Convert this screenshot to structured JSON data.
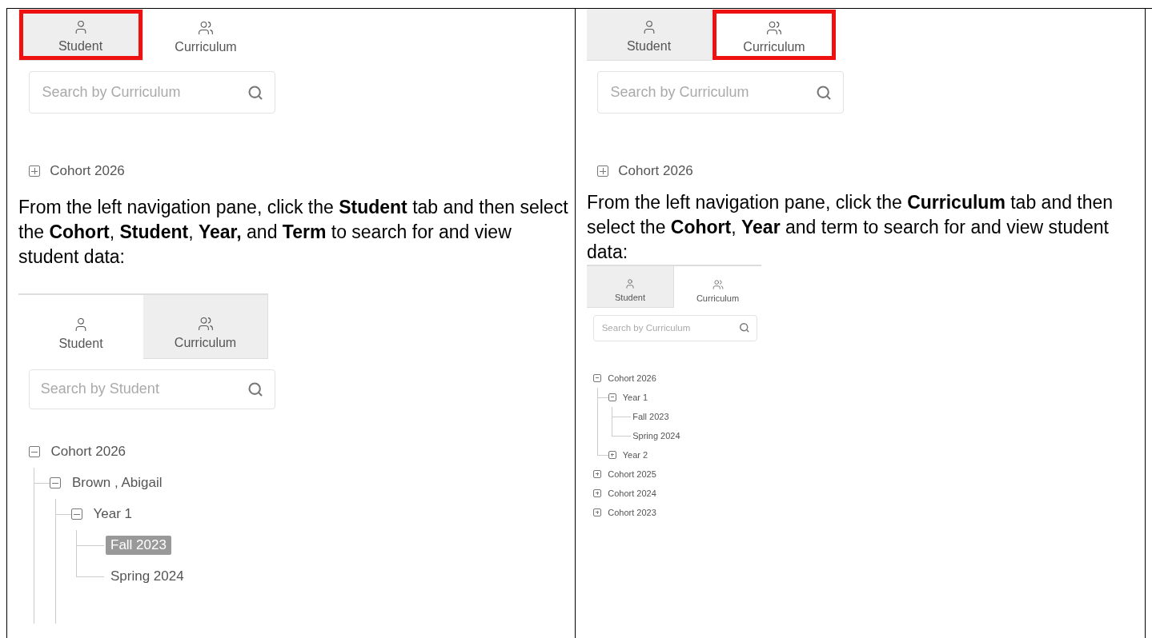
{
  "columns": [
    {
      "screenshot": {
        "kind": "cropped",
        "tabs": [
          {
            "label": "Student",
            "selected": false,
            "highlighted": true
          },
          {
            "label": "Curriculum",
            "selected": true,
            "highlighted": false
          }
        ],
        "search": {
          "placeholder": "Search by Curriculum"
        },
        "tree": [
          {
            "label": "Cohort 2026",
            "expanded": false,
            "selected": false
          }
        ]
      },
      "instruction": "From the left navigation pane, click the **Student** tab and then select the **Cohort**, **Student**, **Year,** and **Term** to search for and view student data:",
      "example": {
        "kind": "full",
        "tabs": [
          {
            "label": "Student",
            "selected": true,
            "highlighted": false
          },
          {
            "label": "Curriculum",
            "selected": false,
            "highlighted": false
          }
        ],
        "search": {
          "placeholder": "Search by Student"
        },
        "tree": [
          {
            "label": "Cohort 2026",
            "expanded": true,
            "continues": true,
            "selected": false,
            "children": [
              {
                "label": "Brown , Abigail",
                "expanded": true,
                "continues": true,
                "selected": false,
                "children": [
                  {
                    "label": "Year 1",
                    "expanded": true,
                    "continues": false,
                    "selected": false,
                    "children": [
                      {
                        "label": "Fall 2023",
                        "selected": true
                      },
                      {
                        "label": "Spring 2024",
                        "selected": false
                      }
                    ]
                  }
                ]
              }
            ]
          }
        ]
      }
    },
    {
      "screenshot": {
        "kind": "cropped",
        "tabs": [
          {
            "label": "Student",
            "selected": false,
            "highlighted": false
          },
          {
            "label": "Curriculum",
            "selected": true,
            "highlighted": true
          }
        ],
        "search": {
          "placeholder": "Search by Curriculum"
        },
        "tree": [
          {
            "label": "Cohort 2026",
            "expanded": false,
            "selected": false
          }
        ]
      },
      "instruction": "From the left navigation pane, click the **Curriculum** tab and then select the **Cohort**, **Year** and term to search for and view student data:",
      "example": {
        "kind": "compact",
        "tabs": [
          {
            "label": "Student",
            "selected": false,
            "highlighted": false
          },
          {
            "label": "Curriculum",
            "selected": true,
            "highlighted": false
          }
        ],
        "search": {
          "placeholder": "Search by Curriculum"
        },
        "tree": [
          {
            "label": "Cohort 2026",
            "expanded": true,
            "continues": false,
            "selected": false,
            "children": [
              {
                "label": "Year 1",
                "expanded": true,
                "continues": false,
                "selected": false,
                "children": [
                  {
                    "label": "Fall 2023",
                    "selected": false
                  },
                  {
                    "label": "Spring 2024",
                    "selected": false
                  }
                ]
              },
              {
                "label": "Year 2",
                "expanded": false,
                "selected": false
              }
            ]
          },
          {
            "label": "Cohort 2025",
            "expanded": false,
            "selected": false
          },
          {
            "label": "Cohort 2024",
            "expanded": false,
            "selected": false
          },
          {
            "label": "Cohort 2023",
            "expanded": false,
            "selected": false
          }
        ]
      }
    }
  ]
}
